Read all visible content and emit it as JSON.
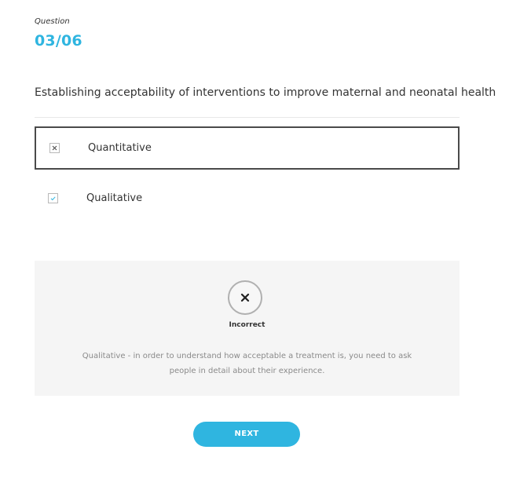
{
  "question": {
    "label": "Question",
    "counter": "03/06",
    "text": "Establishing acceptability of interventions to improve maternal and neonatal health"
  },
  "options": [
    {
      "label": "Quantitative",
      "state": "selected-incorrect",
      "icon": "cross-icon"
    },
    {
      "label": "Qualitative",
      "state": "correct-answer",
      "icon": "check-icon"
    }
  ],
  "feedback": {
    "status_icon": "cross-icon",
    "status": "Incorrect",
    "explanation": "Qualitative - in order to understand how acceptable a treatment is, you need to ask people in detail about their experience."
  },
  "actions": {
    "next_label": "NEXT"
  },
  "colors": {
    "accent": "#2fb5e0",
    "feedback_bg": "#f5f5f5",
    "selected_border": "#4a4a4a"
  }
}
